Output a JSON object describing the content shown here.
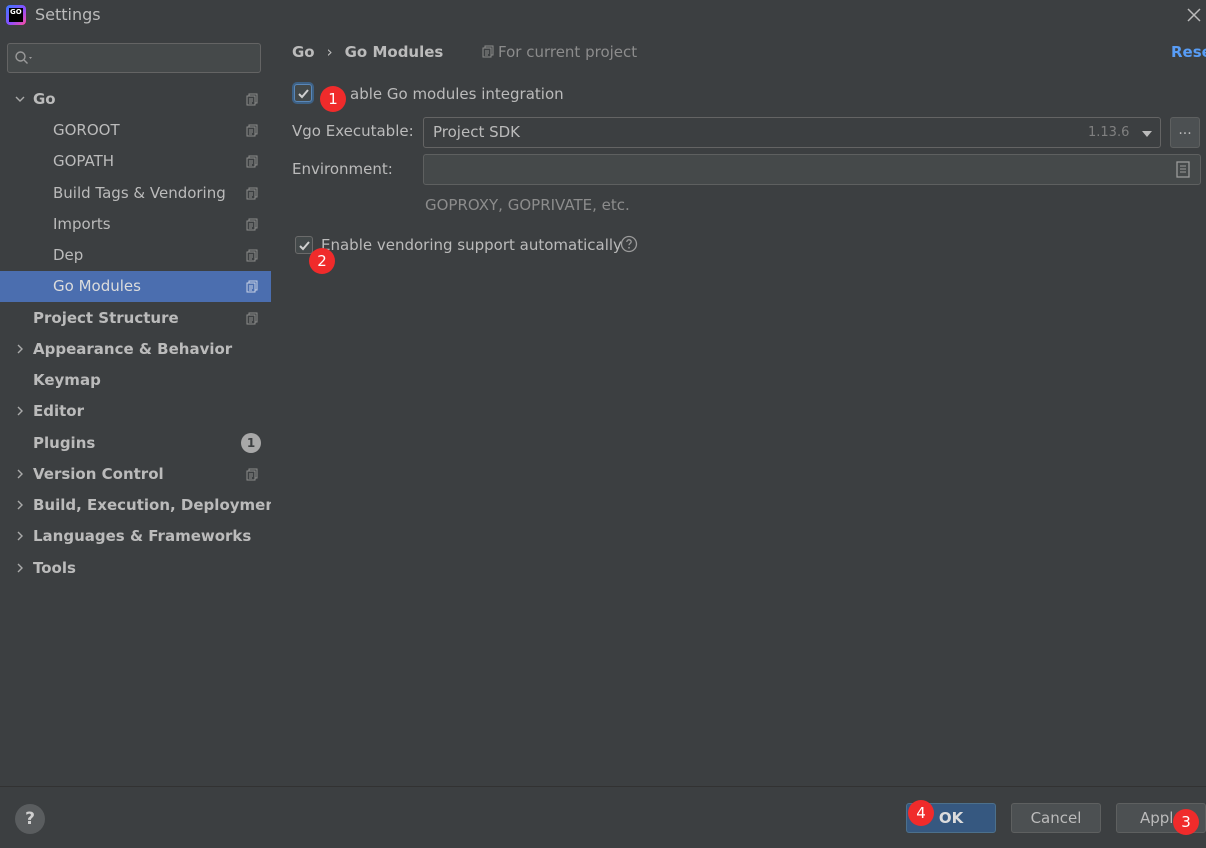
{
  "window": {
    "title": "Settings",
    "logo_text": "GO"
  },
  "sidebar": {
    "search_placeholder": "",
    "items": [
      {
        "label": "Go",
        "expanded": true
      },
      {
        "label": "GOROOT"
      },
      {
        "label": "GOPATH"
      },
      {
        "label": "Build Tags & Vendoring"
      },
      {
        "label": "Imports"
      },
      {
        "label": "Dep"
      },
      {
        "label": "Go Modules",
        "selected": true
      },
      {
        "label": "Project Structure"
      },
      {
        "label": "Appearance & Behavior"
      },
      {
        "label": "Keymap"
      },
      {
        "label": "Editor"
      },
      {
        "label": "Plugins",
        "badge": "1"
      },
      {
        "label": "Version Control"
      },
      {
        "label": "Build, Execution, Deployment"
      },
      {
        "label": "Languages & Frameworks"
      },
      {
        "label": "Tools"
      }
    ]
  },
  "main": {
    "breadcrumb": {
      "parent": "Go",
      "separator": "›",
      "current": "Go Modules"
    },
    "scope_label": "For current project",
    "reset_label": "Rese",
    "enable_modules": {
      "label": "able Go modules integration",
      "checked": true
    },
    "vgo_executable": {
      "label": "Vgo Executable:",
      "value": "Project SDK",
      "version": "1.13.6",
      "browse_label": "..."
    },
    "environment": {
      "label": "Environment:",
      "value": "",
      "hint": "GOPROXY, GOPRIVATE, etc."
    },
    "vendoring": {
      "label": "Enable vendoring support automatically",
      "checked": true
    }
  },
  "footer": {
    "help_label": "?",
    "ok_label": "OK",
    "cancel_label": "Cancel",
    "apply_label": "Appl"
  },
  "markers": [
    "1",
    "2",
    "3",
    "4"
  ],
  "colors": {
    "background": "#3c3f41",
    "selection": "#4b6eaf",
    "link": "#589df6",
    "ok_button": "#365880",
    "marker": "#f02b2b"
  }
}
